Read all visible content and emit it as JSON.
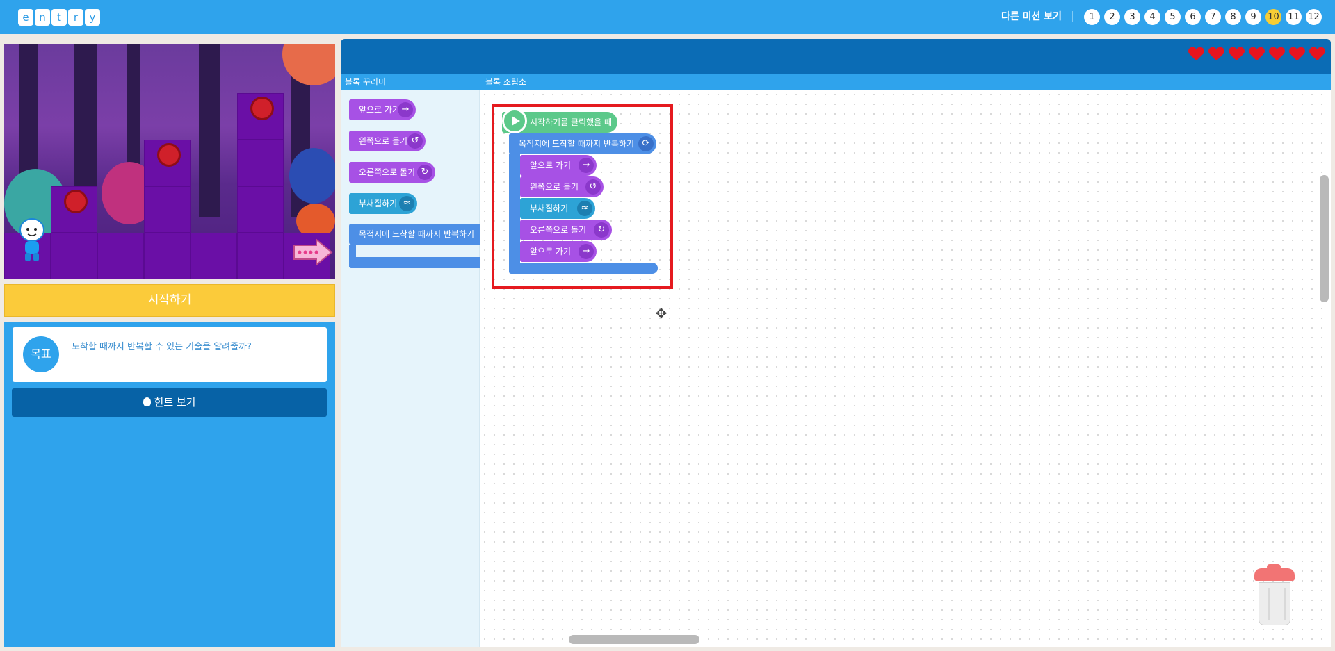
{
  "logo": {
    "letters": [
      "e",
      "n",
      "t",
      "r",
      "y"
    ]
  },
  "header": {
    "other_missions_label": "다른 미션 보기",
    "missions": [
      "1",
      "2",
      "3",
      "4",
      "5",
      "6",
      "7",
      "8",
      "9",
      "10",
      "11",
      "12"
    ],
    "active_mission": "10"
  },
  "stage": {
    "start_label": "시작하기"
  },
  "goal": {
    "badge": "목표",
    "text": "도착할 때까지 반복할 수 있는 기술을 알려줄까?"
  },
  "hint": {
    "label": "힌트 보기"
  },
  "workspace": {
    "lives": 7,
    "palette_tab": "블록 꾸러미",
    "assembly_tab": "블록 조립소",
    "palette_blocks": [
      {
        "label": "앞으로 가기",
        "icon": "arrow-right-icon"
      },
      {
        "label": "왼쪽으로 돌기",
        "icon": "rotate-left-icon"
      },
      {
        "label": "오른쪽으로 돌기",
        "icon": "rotate-right-icon"
      },
      {
        "label": "부채질하기",
        "icon": "fan-icon"
      },
      {
        "label": "목적지에 도착할 때까지 반복하기",
        "icon": "repeat-icon"
      }
    ],
    "script": {
      "trigger": "시작하기를 클릭했을 때",
      "loop": "목적지에 도착할 때까지 반복하기",
      "body": [
        "앞으로 가기",
        "왼쪽으로 돌기",
        "부채질하기",
        "오른쪽으로 돌기",
        "앞으로 가기"
      ]
    }
  },
  "colors": {
    "primary": "#2fa3ec",
    "start_button": "#fbcb3a",
    "hint_button": "#0762a6",
    "motion_block": "#a751e5",
    "loop_block": "#4d8fe6",
    "trigger_block": "#5cc98a",
    "highlight": "#e51a1f"
  }
}
